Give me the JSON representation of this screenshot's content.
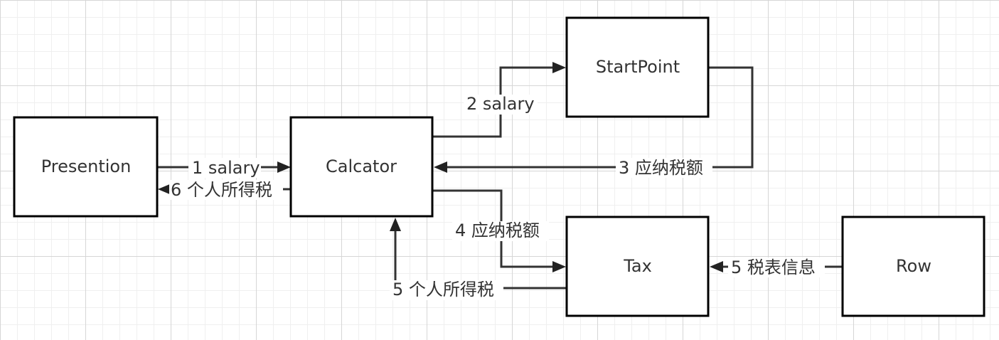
{
  "nodes": {
    "presention": "Presention",
    "calcator": "Calcator",
    "startpoint": "StartPoint",
    "tax": "Tax",
    "row": "Row"
  },
  "edges": {
    "e1": "1 salary",
    "e2": "2 salary",
    "e3": "3 应纳税额",
    "e4": "4 应纳税额",
    "e5a": "5 个人所得税",
    "e5b": "5 税表信息",
    "e6": "6 个人所得税"
  }
}
